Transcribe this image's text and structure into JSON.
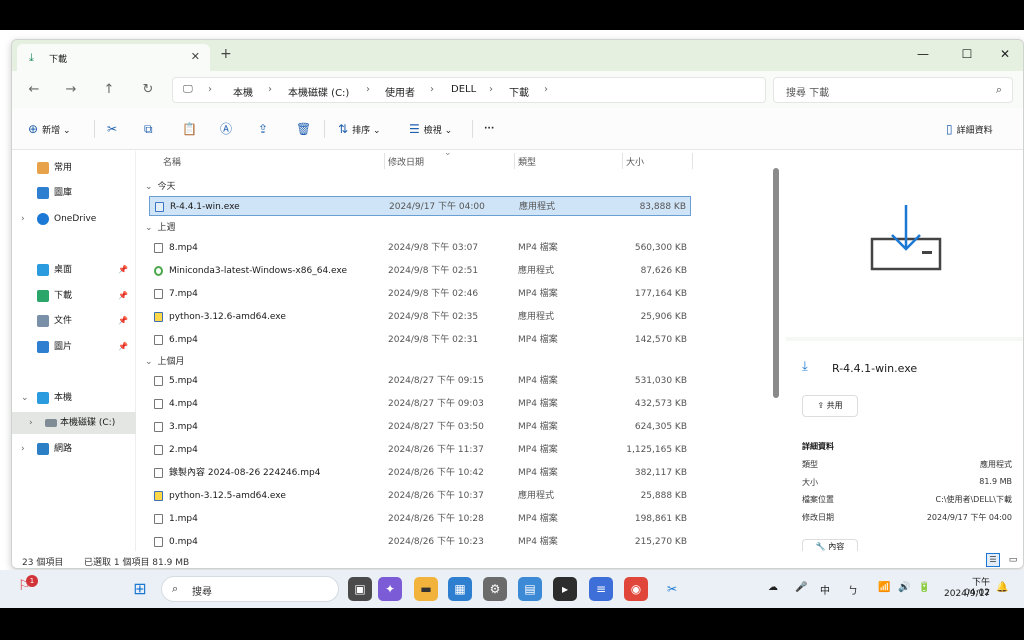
{
  "window": {
    "tab_title": "下載",
    "address": [
      "本機",
      "本機磁碟 (C:)",
      "使用者",
      "DELL",
      "下載"
    ],
    "search_placeholder": "搜尋 下載"
  },
  "toolbar": {
    "new_label": "新增",
    "sort_label": "排序",
    "view_label": "檢視",
    "more_label": "···",
    "details_label": "詳細資料"
  },
  "nav": {
    "home": "常用",
    "gallery": "圖庫",
    "onedrive": "OneDrive",
    "desktop": "桌面",
    "downloads": "下載",
    "documents": "文件",
    "pictures": "圖片",
    "thispc": "本機",
    "cdrive": "本機磁碟 (C:)",
    "network": "網路"
  },
  "columns": {
    "name": "名稱",
    "modified": "修改日期",
    "type": "類型",
    "size": "大小"
  },
  "groups": {
    "today": "今天",
    "last_week": "上週",
    "last_month": "上個月"
  },
  "files": [
    {
      "name": "R-4.4.1-win.exe",
      "date": "2024/9/17 下午 04:00",
      "type": "應用程式",
      "size": "83,888 KB"
    },
    {
      "name": "8.mp4",
      "date": "2024/9/8 下午 03:07",
      "type": "MP4 檔案",
      "size": "560,300 KB"
    },
    {
      "name": "Miniconda3-latest-Windows-x86_64.exe",
      "date": "2024/9/8 下午 02:51",
      "type": "應用程式",
      "size": "87,626 KB"
    },
    {
      "name": "7.mp4",
      "date": "2024/9/8 下午 02:46",
      "type": "MP4 檔案",
      "size": "177,164 KB"
    },
    {
      "name": "python-3.12.6-amd64.exe",
      "date": "2024/9/8 下午 02:35",
      "type": "應用程式",
      "size": "25,906 KB"
    },
    {
      "name": "6.mp4",
      "date": "2024/9/8 下午 02:31",
      "type": "MP4 檔案",
      "size": "142,570 KB"
    },
    {
      "name": "5.mp4",
      "date": "2024/8/27 下午 09:15",
      "type": "MP4 檔案",
      "size": "531,030 KB"
    },
    {
      "name": "4.mp4",
      "date": "2024/8/27 下午 09:03",
      "type": "MP4 檔案",
      "size": "432,573 KB"
    },
    {
      "name": "3.mp4",
      "date": "2024/8/27 下午 03:50",
      "type": "MP4 檔案",
      "size": "624,305 KB"
    },
    {
      "name": "2.mp4",
      "date": "2024/8/26 下午 11:37",
      "type": "MP4 檔案",
      "size": "1,125,165 KB"
    },
    {
      "name": "錄製內容 2024-08-26 224246.mp4",
      "date": "2024/8/26 下午 10:42",
      "type": "MP4 檔案",
      "size": "382,117 KB"
    },
    {
      "name": "python-3.12.5-amd64.exe",
      "date": "2024/8/26 下午 10:37",
      "type": "應用程式",
      "size": "25,888 KB"
    },
    {
      "name": "1.mp4",
      "date": "2024/8/26 下午 10:28",
      "type": "MP4 檔案",
      "size": "198,861 KB"
    },
    {
      "name": "0.mp4",
      "date": "2024/8/26 下午 10:23",
      "type": "MP4 檔案",
      "size": "215,270 KB"
    }
  ],
  "details": {
    "file_name": "R-4.4.1-win.exe",
    "share_label": "共用",
    "section_title": "詳細資料",
    "fields": [
      {
        "k": "類型",
        "v": "應用程式"
      },
      {
        "k": "大小",
        "v": "81.9 MB"
      },
      {
        "k": "檔案位置",
        "v": "C:\\使用者\\DELL\\下載"
      },
      {
        "k": "修改日期",
        "v": "2024/9/17 下午 04:00"
      }
    ],
    "props_label": "內容"
  },
  "status": {
    "count": "23 個項目",
    "selected": "已選取 1 個項目 81.9 MB"
  },
  "taskbar": {
    "search": "搜尋",
    "ime": "中",
    "time": "下午 04:02",
    "date": "2024/9/17",
    "notif": "1"
  }
}
